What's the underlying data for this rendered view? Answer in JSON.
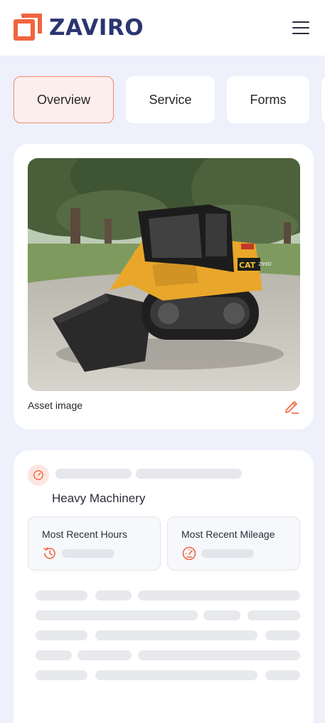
{
  "header": {
    "brand_name": "ZAVIRO",
    "colors": {
      "brand": "#2b3570",
      "accent": "#f0653f"
    },
    "icons": {
      "logo": "zaviro-logo-icon",
      "menu": "hamburger-menu-icon"
    }
  },
  "tabs": [
    {
      "label": "Overview",
      "active": true
    },
    {
      "label": "Service",
      "active": false
    },
    {
      "label": "Forms",
      "active": false
    },
    {
      "label": "",
      "active": false
    }
  ],
  "asset_image": {
    "caption": "Asset image",
    "edit_icon": "pencil-icon",
    "photo_text": {
      "brand": "CAT",
      "model": "299D"
    }
  },
  "details": {
    "category_icon": "gauge-icon",
    "category": "Heavy Machinery",
    "metrics": [
      {
        "title": "Most Recent Hours",
        "icon": "clock-history-icon"
      },
      {
        "title": "Most Recent Mileage",
        "icon": "speedometer-icon"
      }
    ]
  }
}
